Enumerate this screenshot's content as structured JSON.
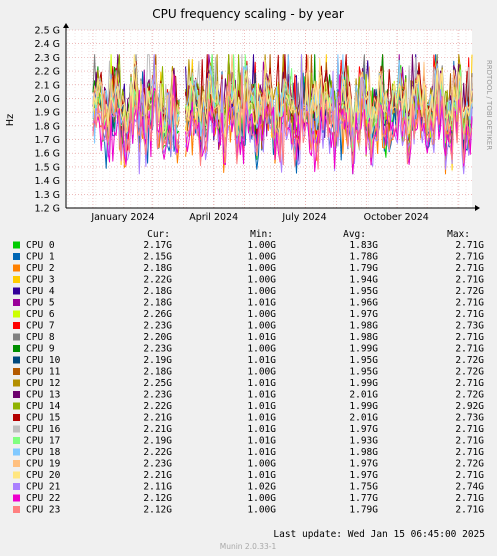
{
  "window": {
    "title": "CPU frequency scaling - by year",
    "watermark": "RRDTOOL / TOBI OETIKER",
    "footer": "Munin 2.0.33-1"
  },
  "legend": {
    "headers": {
      "cur": "Cur:",
      "min": "Min:",
      "avg": "Avg:",
      "max": "Max:"
    },
    "last_update": "Last update:  Wed Jan 15 06:45:00 2025"
  },
  "chart_data": {
    "type": "line",
    "title": "CPU frequency scaling - by year",
    "ylabel": "Hz",
    "xlabel": "",
    "y_ticks": [
      "2.5 G",
      "2.4 G",
      "2.3 G",
      "2.2 G",
      "2.1 G",
      "2.0 G",
      "1.9 G",
      "1.8 G",
      "1.7 G",
      "1.6 G",
      "1.5 G",
      "1.4 G",
      "1.3 G",
      "1.2 G"
    ],
    "ylim": [
      1.2,
      2.5
    ],
    "y_unit": "GHz",
    "x_ticks": [
      "January 2024",
      "April 2024",
      "July 2024",
      "October 2024"
    ],
    "x_range": [
      "2023-12-05",
      "2025-01-15"
    ],
    "grid": true,
    "series": [
      {
        "name": "CPU 0",
        "color": "#00CC00",
        "cur": "2.17G",
        "min": "1.00G",
        "avg": "1.83G",
        "max": "2.71G"
      },
      {
        "name": "CPU 1",
        "color": "#0066B3",
        "cur": "2.15G",
        "min": "1.00G",
        "avg": "1.78G",
        "max": "2.71G"
      },
      {
        "name": "CPU 2",
        "color": "#FF8000",
        "cur": "2.18G",
        "min": "1.00G",
        "avg": "1.79G",
        "max": "2.71G"
      },
      {
        "name": "CPU 3",
        "color": "#FFCC00",
        "cur": "2.22G",
        "min": "1.00G",
        "avg": "1.94G",
        "max": "2.71G"
      },
      {
        "name": "CPU 4",
        "color": "#330099",
        "cur": "2.18G",
        "min": "1.00G",
        "avg": "1.95G",
        "max": "2.72G"
      },
      {
        "name": "CPU 5",
        "color": "#990099",
        "cur": "2.18G",
        "min": "1.01G",
        "avg": "1.96G",
        "max": "2.71G"
      },
      {
        "name": "CPU 6",
        "color": "#CCFF00",
        "cur": "2.26G",
        "min": "1.00G",
        "avg": "1.97G",
        "max": "2.71G"
      },
      {
        "name": "CPU 7",
        "color": "#FF0000",
        "cur": "2.23G",
        "min": "1.00G",
        "avg": "1.98G",
        "max": "2.73G"
      },
      {
        "name": "CPU 8",
        "color": "#808080",
        "cur": "2.20G",
        "min": "1.01G",
        "avg": "1.98G",
        "max": "2.71G"
      },
      {
        "name": "CPU 9",
        "color": "#008F00",
        "cur": "2.23G",
        "min": "1.00G",
        "avg": "1.99G",
        "max": "2.71G"
      },
      {
        "name": "CPU 10",
        "color": "#00487D",
        "cur": "2.19G",
        "min": "1.01G",
        "avg": "1.95G",
        "max": "2.72G"
      },
      {
        "name": "CPU 11",
        "color": "#B35A00",
        "cur": "2.18G",
        "min": "1.00G",
        "avg": "1.95G",
        "max": "2.72G"
      },
      {
        "name": "CPU 12",
        "color": "#B38F00",
        "cur": "2.25G",
        "min": "1.01G",
        "avg": "1.99G",
        "max": "2.71G"
      },
      {
        "name": "CPU 13",
        "color": "#6B006B",
        "cur": "2.23G",
        "min": "1.01G",
        "avg": "2.01G",
        "max": "2.72G"
      },
      {
        "name": "CPU 14",
        "color": "#8FB300",
        "cur": "2.22G",
        "min": "1.01G",
        "avg": "1.99G",
        "max": "2.92G"
      },
      {
        "name": "CPU 15",
        "color": "#B30000",
        "cur": "2.21G",
        "min": "1.01G",
        "avg": "2.01G",
        "max": "2.73G"
      },
      {
        "name": "CPU 16",
        "color": "#BEBEBE",
        "cur": "2.21G",
        "min": "1.01G",
        "avg": "1.97G",
        "max": "2.71G"
      },
      {
        "name": "CPU 17",
        "color": "#80FF80",
        "cur": "2.19G",
        "min": "1.01G",
        "avg": "1.93G",
        "max": "2.71G"
      },
      {
        "name": "CPU 18",
        "color": "#80C9FF",
        "cur": "2.22G",
        "min": "1.01G",
        "avg": "1.98G",
        "max": "2.71G"
      },
      {
        "name": "CPU 19",
        "color": "#FFC080",
        "cur": "2.23G",
        "min": "1.00G",
        "avg": "1.97G",
        "max": "2.72G"
      },
      {
        "name": "CPU 20",
        "color": "#FFE680",
        "cur": "2.21G",
        "min": "1.01G",
        "avg": "1.97G",
        "max": "2.71G"
      },
      {
        "name": "CPU 21",
        "color": "#AA80FF",
        "cur": "2.11G",
        "min": "1.02G",
        "avg": "1.75G",
        "max": "2.74G"
      },
      {
        "name": "CPU 22",
        "color": "#EE00CC",
        "cur": "2.12G",
        "min": "1.00G",
        "avg": "1.77G",
        "max": "2.71G"
      },
      {
        "name": "CPU 23",
        "color": "#FF8080",
        "cur": "2.12G",
        "min": "1.00G",
        "avg": "1.79G",
        "max": "2.71G"
      }
    ]
  }
}
